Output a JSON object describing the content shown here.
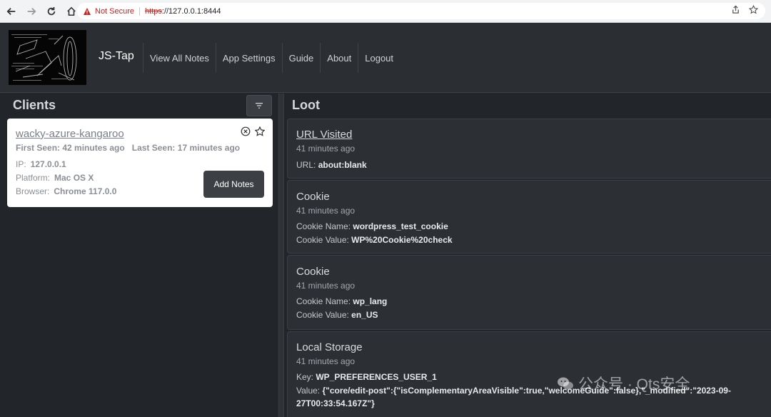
{
  "browser": {
    "security_label": "Not Secure",
    "url_scheme": "https",
    "url_rest": "://127.0.0.1:8444"
  },
  "header": {
    "brand": "JS-Tap",
    "nav": [
      "View All Notes",
      "App Settings",
      "Guide",
      "About",
      "Logout"
    ]
  },
  "clients": {
    "title": "Clients",
    "card": {
      "name": "wacky-azure-kangaroo",
      "first_seen_label": "First Seen:",
      "first_seen": "42 minutes ago",
      "last_seen_label": "Last Seen:",
      "last_seen": "17 minutes ago",
      "ip_label": "IP:",
      "ip": "127.0.0.1",
      "platform_label": "Platform:",
      "platform": "Mac OS X",
      "browser_label": "Browser:",
      "browser": "Chrome 117.0.0",
      "add_notes": "Add Notes"
    }
  },
  "loot": {
    "title": "Loot",
    "items": [
      {
        "title": "URL Visited",
        "time": "41 minutes ago",
        "lines": [
          {
            "label": "URL: ",
            "value": "about:blank"
          }
        ]
      },
      {
        "title": "Cookie",
        "time": "41 minutes ago",
        "lines": [
          {
            "label": "Cookie Name: ",
            "value": "wordpress_test_cookie"
          },
          {
            "label": "Cookie Value: ",
            "value": "WP%20Cookie%20check"
          }
        ]
      },
      {
        "title": "Cookie",
        "time": "41 minutes ago",
        "lines": [
          {
            "label": "Cookie Name: ",
            "value": "wp_lang"
          },
          {
            "label": "Cookie Value: ",
            "value": "en_US"
          }
        ]
      },
      {
        "title": "Local Storage",
        "time": "41 minutes ago",
        "lines": [
          {
            "label": "Key: ",
            "value": "WP_PREFERENCES_USER_1"
          },
          {
            "label": "Value: ",
            "value": "{\"core/edit-post\":{\"isComplementaryAreaVisible\":true,\"welcomeGuide\":false},\"_modified\":\"2023-09-"
          },
          {
            "label": "",
            "value": "27T00:33:54.167Z\"}"
          }
        ]
      }
    ]
  },
  "watermark": "公众号 · Qts安全",
  "colors": {
    "security_warning": "#c5221f",
    "card_bg": "#ffffff",
    "page_bg": "#24272b"
  }
}
